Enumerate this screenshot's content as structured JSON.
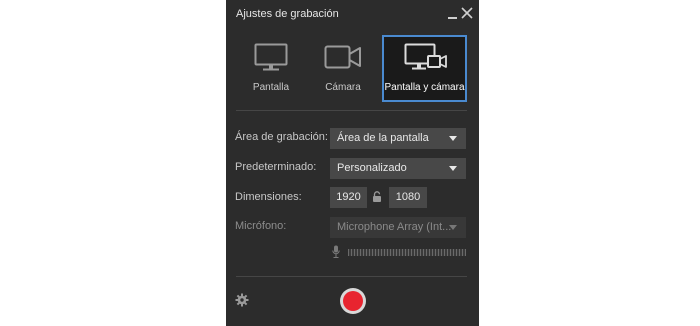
{
  "window": {
    "title": "Ajustes de grabación"
  },
  "modes": [
    {
      "label": "Pantalla",
      "icon": "monitor-icon",
      "selected": false
    },
    {
      "label": "Cámara",
      "icon": "camera-icon",
      "selected": false
    },
    {
      "label": "Pantalla y cámara",
      "icon": "monitor-camera-icon",
      "selected": true
    }
  ],
  "settings": {
    "area": {
      "label": "Área de grabación:",
      "value": "Área de la pantalla"
    },
    "preset": {
      "label": "Predeterminado:",
      "value": "Personalizado"
    },
    "dimensions": {
      "label": "Dimensiones:",
      "width": "1920",
      "height": "1080"
    },
    "microphone": {
      "label": "Micrófono:",
      "value": "Microphone Array (Int...",
      "disabled": true
    }
  },
  "footer": {
    "settings_icon": "gear-icon",
    "record_icon": "record-icon"
  },
  "colors": {
    "panel_bg": "#2c2c2c",
    "accent": "#4a8ad0",
    "record": "#e8242f"
  }
}
